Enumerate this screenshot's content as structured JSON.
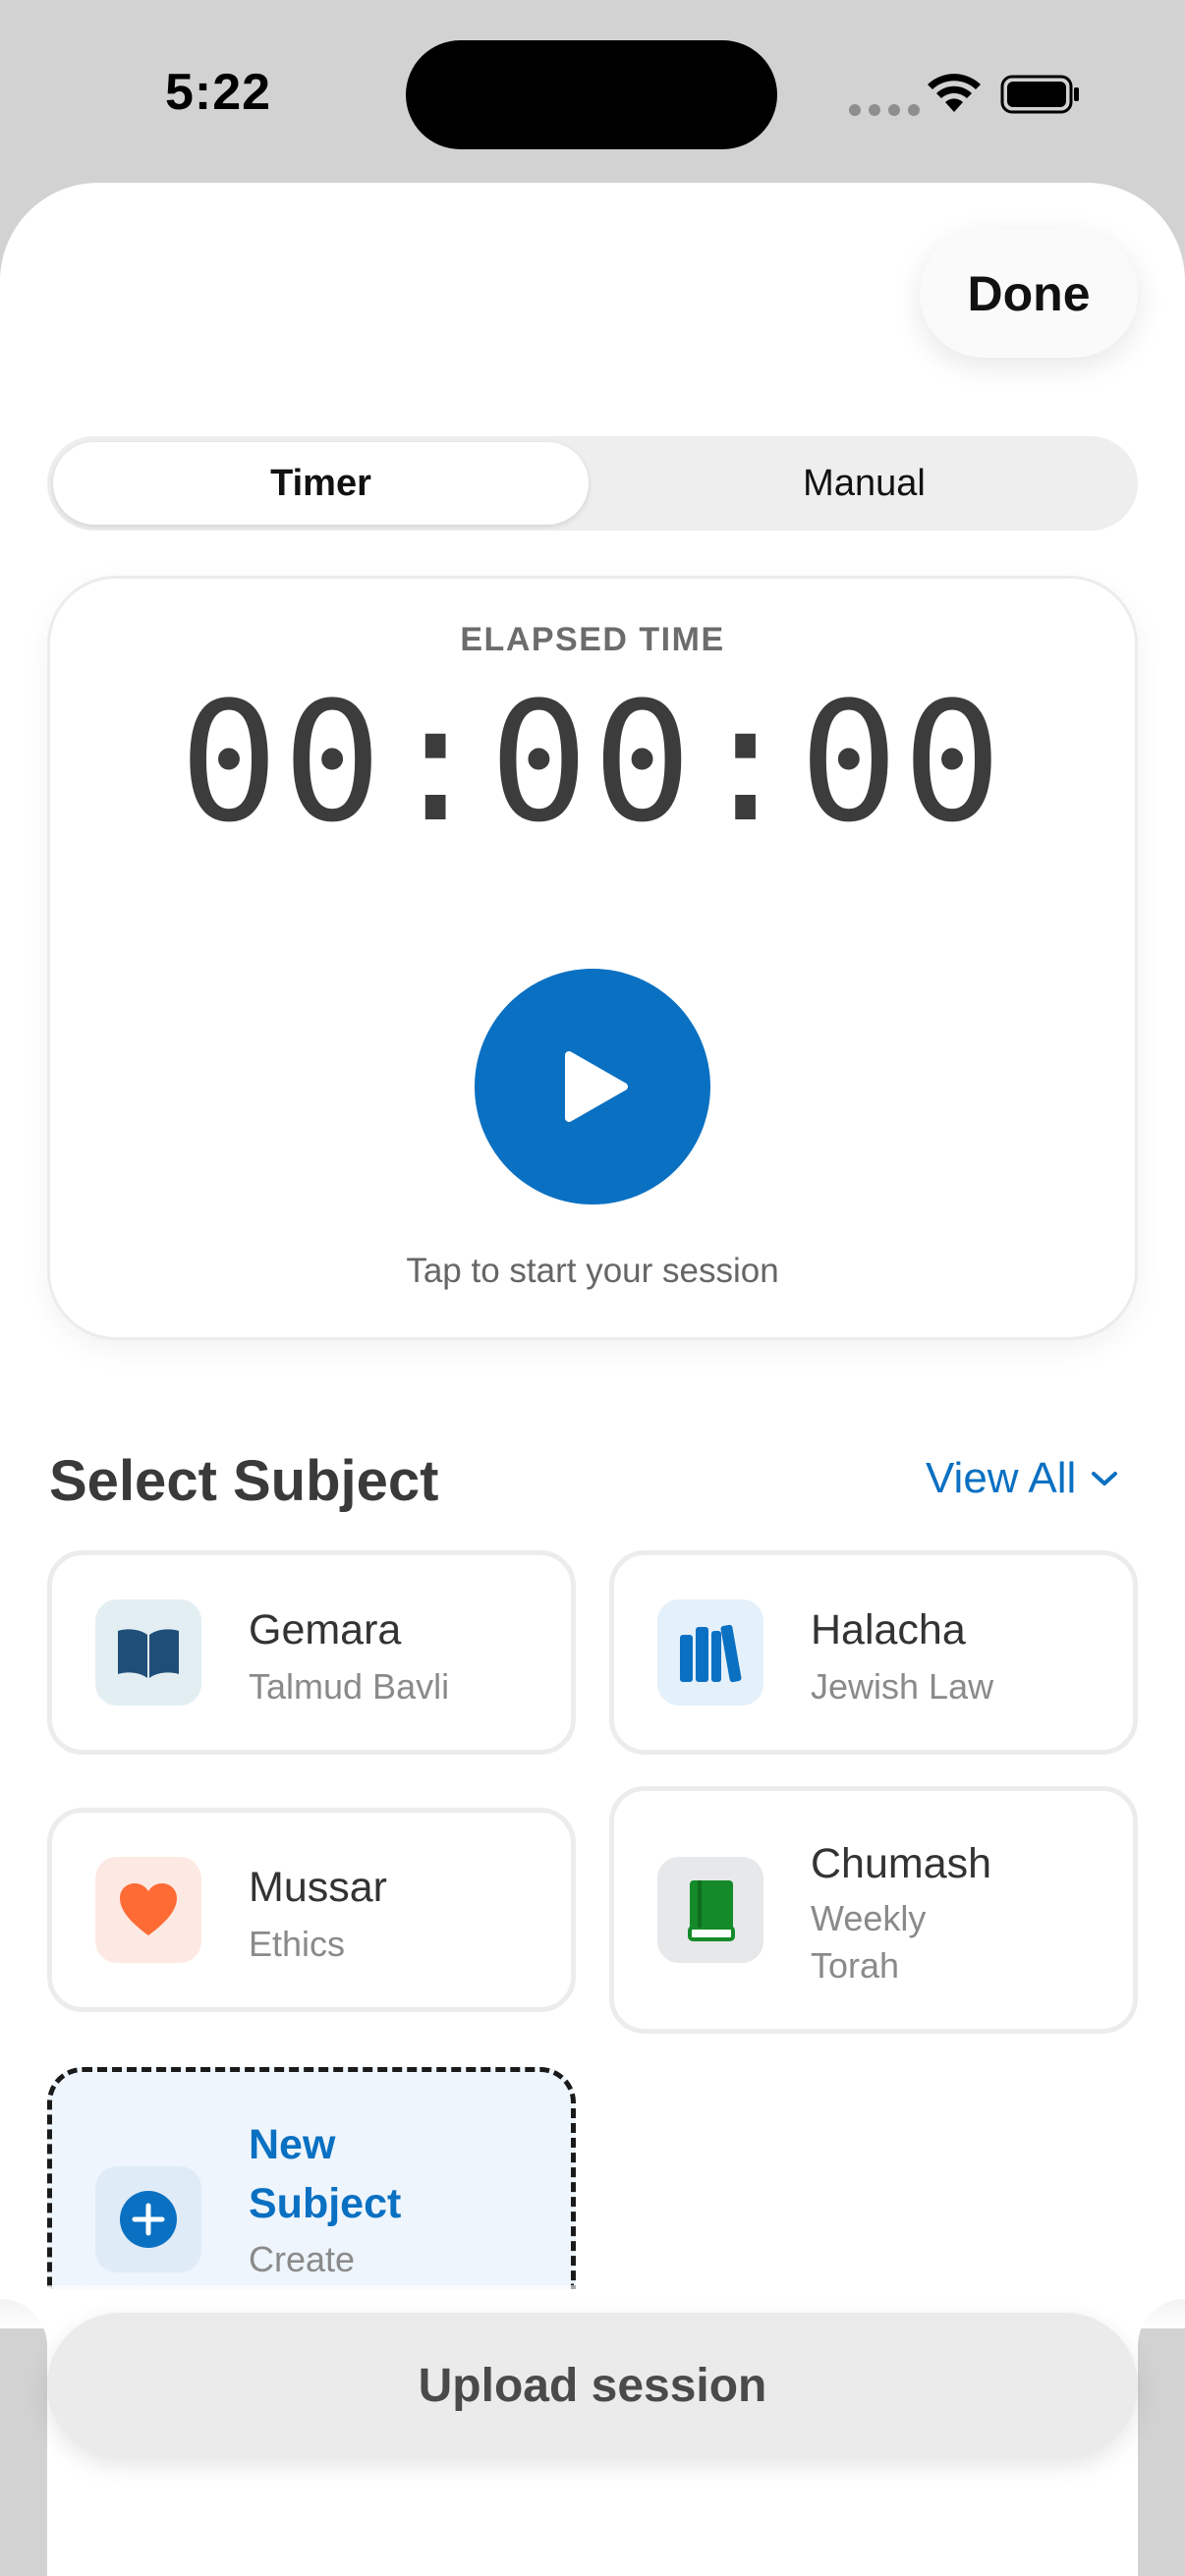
{
  "status_bar": {
    "time": "5:22"
  },
  "header": {
    "done_label": "Done"
  },
  "mode_tabs": {
    "timer_label": "Timer",
    "manual_label": "Manual",
    "selected": "Timer"
  },
  "timer": {
    "elapsed_label": "ELAPSED TIME",
    "display": "00:00:00",
    "hint": "Tap to start your session"
  },
  "subjects": {
    "section_title": "Select Subject",
    "view_all_label": "View All",
    "items": [
      {
        "title": "Gemara",
        "subtitle": "Talmud Bavli",
        "icon": "open-book-icon",
        "icon_color": "#1f4e79",
        "icon_bg": "#e3eef2"
      },
      {
        "title": "Halacha",
        "subtitle": "Jewish Law",
        "icon": "books-icon",
        "icon_color": "#0a70c2",
        "icon_bg": "#e4f0fa"
      },
      {
        "title": "Mussar",
        "subtitle": "Ethics",
        "icon": "heart-icon",
        "icon_color": "#ff6b35",
        "icon_bg": "#fde9e3"
      },
      {
        "title": "Chumash",
        "subtitle_line1": "Weekly",
        "subtitle_line2": "Torah",
        "icon": "green-book-icon",
        "icon_color": "#158a28",
        "icon_bg": "#e6e8ea"
      }
    ],
    "new_subject": {
      "title_line1": "New",
      "title_line2": "Subject",
      "subtitle": "Create",
      "icon": "plus-circle-icon"
    }
  },
  "footer": {
    "upload_label": "Upload session"
  },
  "colors": {
    "accent": "#0a70c2",
    "background": "#d2d2d2"
  }
}
